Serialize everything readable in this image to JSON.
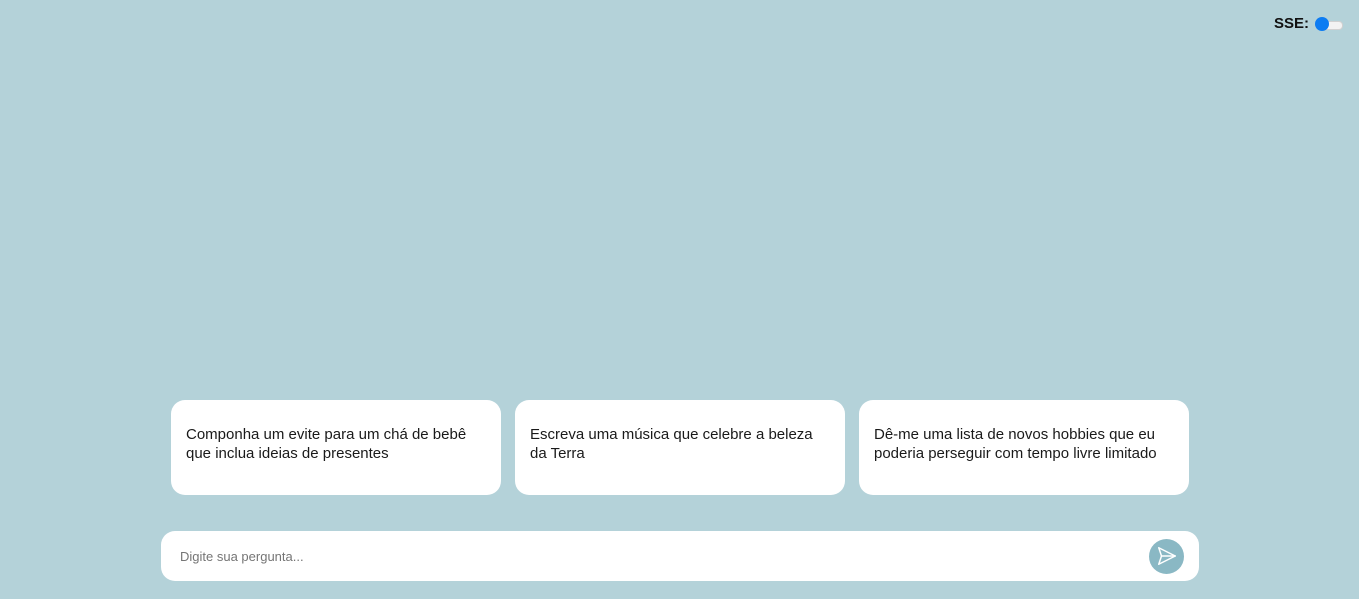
{
  "sse": {
    "label": "SSE:",
    "enabled": false
  },
  "suggestions": [
    {
      "text": "Componha um evite para um chá de bebê que inclua ideias de presentes"
    },
    {
      "text": "Escreva uma música que celebre a beleza da Terra"
    },
    {
      "text": "Dê-me uma lista de novos hobbies que eu poderia perseguir com tempo livre limitado"
    }
  ],
  "chat_input": {
    "placeholder": "Digite sua pergunta...",
    "value": ""
  },
  "send_button": {
    "icon": "send-icon"
  },
  "colors": {
    "background": "#b4d2d9",
    "card": "#ffffff",
    "toggle_accent": "#0d7cf2",
    "send_button": "#8ab8c4"
  }
}
